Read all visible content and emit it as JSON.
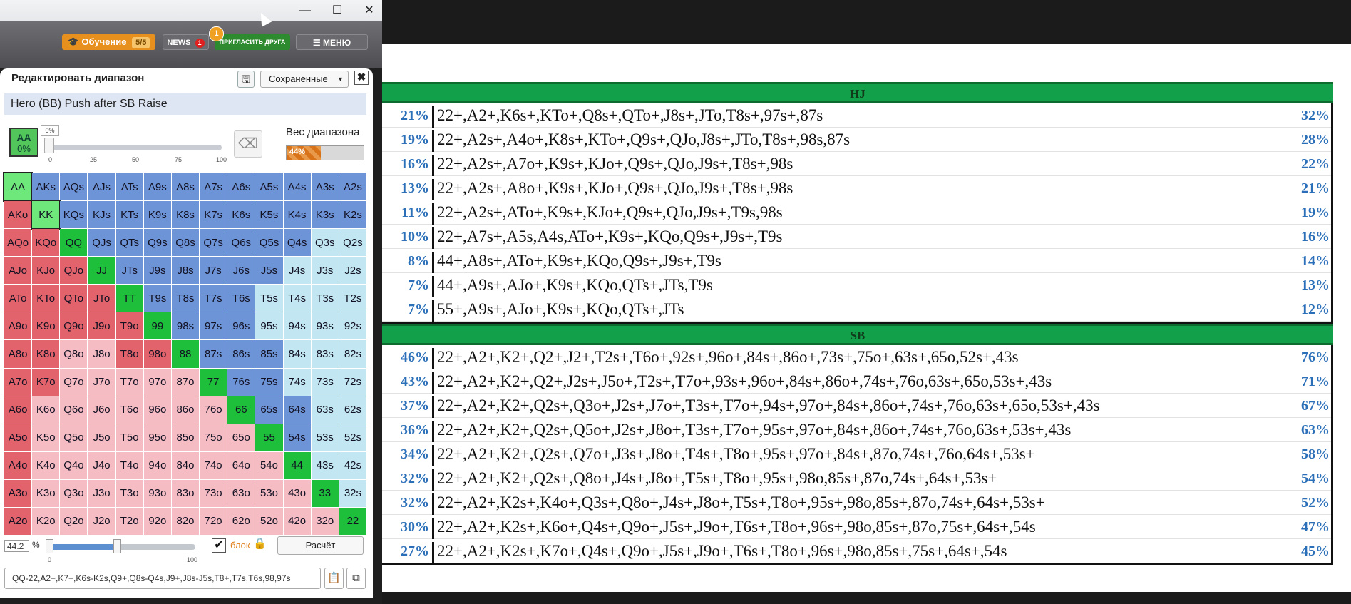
{
  "window": {
    "minimize": "—",
    "maximize": "☐",
    "close": "✕"
  },
  "toolbar": {
    "learn_icon": "🎓",
    "learn_label": "Обучение",
    "learn_count": "5/5",
    "news_label": "NEWS",
    "news_badge": "1",
    "invite_label": "ПРИГЛАСИТЬ ДРУГА",
    "invite_badge": "1",
    "menu_icon": "☰",
    "menu_label": "МЕНЮ"
  },
  "panel": {
    "title": "Редактировать диапазон",
    "save_icon": "🖫",
    "saved_label": "Сохранённые",
    "saved_caret": "▼",
    "close_icon": "✖",
    "range_name": "Hero (BB) Push after SB Raise",
    "combo_label": "AA",
    "combo_pct": "0%",
    "slider_tip": "0%",
    "ticks": [
      "0",
      "25",
      "50",
      "75",
      "100"
    ],
    "eraser_icon": "⌫",
    "weight_label": "Вес диапазона",
    "weight_pct": 44,
    "weight_text": "44%",
    "pct_value": "44.2",
    "pct_sign": "%",
    "bottom_ticks": [
      "0",
      "100"
    ],
    "block_check": "✔",
    "block_label": "блок",
    "lock_icon": "🔒",
    "calc_label": "Расчёт",
    "range_string": "QQ-22,A2+,K7+,K6s-K2s,Q9+,Q8s-Q4s,J9+,J8s-J5s,T8+,T7s,T6s,98,97s",
    "paste_icon": "📋",
    "copy_icon": "⧉"
  },
  "grid": {
    "colors": {
      "pair": "#1ebf3a",
      "selected": "#6ee87a",
      "suited": "#6e94d8",
      "suited_light": "#c2e6f2",
      "offsuit": "#e2636c",
      "offsuit_light": "#f5bcc4"
    },
    "cells": [
      [
        "AA",
        "selected"
      ],
      [
        "AKs",
        "suited"
      ],
      [
        "AQs",
        "suited"
      ],
      [
        "AJs",
        "suited"
      ],
      [
        "ATs",
        "suited"
      ],
      [
        "A9s",
        "suited"
      ],
      [
        "A8s",
        "suited"
      ],
      [
        "A7s",
        "suited"
      ],
      [
        "A6s",
        "suited"
      ],
      [
        "A5s",
        "suited"
      ],
      [
        "A4s",
        "suited"
      ],
      [
        "A3s",
        "suited"
      ],
      [
        "A2s",
        "suited"
      ],
      [
        "AKo",
        "offsuit"
      ],
      [
        "KK",
        "selected"
      ],
      [
        "KQs",
        "suited"
      ],
      [
        "KJs",
        "suited"
      ],
      [
        "KTs",
        "suited"
      ],
      [
        "K9s",
        "suited"
      ],
      [
        "K8s",
        "suited"
      ],
      [
        "K7s",
        "suited"
      ],
      [
        "K6s",
        "suited"
      ],
      [
        "K5s",
        "suited"
      ],
      [
        "K4s",
        "suited"
      ],
      [
        "K3s",
        "suited"
      ],
      [
        "K2s",
        "suited"
      ],
      [
        "AQo",
        "offsuit"
      ],
      [
        "KQo",
        "offsuit"
      ],
      [
        "QQ",
        "pair"
      ],
      [
        "QJs",
        "suited"
      ],
      [
        "QTs",
        "suited"
      ],
      [
        "Q9s",
        "suited"
      ],
      [
        "Q8s",
        "suited"
      ],
      [
        "Q7s",
        "suited"
      ],
      [
        "Q6s",
        "suited"
      ],
      [
        "Q5s",
        "suited"
      ],
      [
        "Q4s",
        "suited"
      ],
      [
        "Q3s",
        "suited_light"
      ],
      [
        "Q2s",
        "suited_light"
      ],
      [
        "AJo",
        "offsuit"
      ],
      [
        "KJo",
        "offsuit"
      ],
      [
        "QJo",
        "offsuit"
      ],
      [
        "JJ",
        "pair"
      ],
      [
        "JTs",
        "suited"
      ],
      [
        "J9s",
        "suited"
      ],
      [
        "J8s",
        "suited"
      ],
      [
        "J7s",
        "suited"
      ],
      [
        "J6s",
        "suited"
      ],
      [
        "J5s",
        "suited"
      ],
      [
        "J4s",
        "suited_light"
      ],
      [
        "J3s",
        "suited_light"
      ],
      [
        "J2s",
        "suited_light"
      ],
      [
        "ATo",
        "offsuit"
      ],
      [
        "KTo",
        "offsuit"
      ],
      [
        "QTo",
        "offsuit"
      ],
      [
        "JTo",
        "offsuit"
      ],
      [
        "TT",
        "pair"
      ],
      [
        "T9s",
        "suited"
      ],
      [
        "T8s",
        "suited"
      ],
      [
        "T7s",
        "suited"
      ],
      [
        "T6s",
        "suited"
      ],
      [
        "T5s",
        "suited_light"
      ],
      [
        "T4s",
        "suited_light"
      ],
      [
        "T3s",
        "suited_light"
      ],
      [
        "T2s",
        "suited_light"
      ],
      [
        "A9o",
        "offsuit"
      ],
      [
        "K9o",
        "offsuit"
      ],
      [
        "Q9o",
        "offsuit"
      ],
      [
        "J9o",
        "offsuit"
      ],
      [
        "T9o",
        "offsuit"
      ],
      [
        "99",
        "pair"
      ],
      [
        "98s",
        "suited"
      ],
      [
        "97s",
        "suited"
      ],
      [
        "96s",
        "suited"
      ],
      [
        "95s",
        "suited_light"
      ],
      [
        "94s",
        "suited_light"
      ],
      [
        "93s",
        "suited_light"
      ],
      [
        "92s",
        "suited_light"
      ],
      [
        "A8o",
        "offsuit"
      ],
      [
        "K8o",
        "offsuit"
      ],
      [
        "Q8o",
        "offsuit_light"
      ],
      [
        "J8o",
        "offsuit_light"
      ],
      [
        "T8o",
        "offsuit"
      ],
      [
        "98o",
        "offsuit"
      ],
      [
        "88",
        "pair"
      ],
      [
        "87s",
        "suited"
      ],
      [
        "86s",
        "suited"
      ],
      [
        "85s",
        "suited"
      ],
      [
        "84s",
        "suited_light"
      ],
      [
        "83s",
        "suited_light"
      ],
      [
        "82s",
        "suited_light"
      ],
      [
        "A7o",
        "offsuit"
      ],
      [
        "K7o",
        "offsuit"
      ],
      [
        "Q7o",
        "offsuit_light"
      ],
      [
        "J7o",
        "offsuit_light"
      ],
      [
        "T7o",
        "offsuit_light"
      ],
      [
        "97o",
        "offsuit_light"
      ],
      [
        "87o",
        "offsuit_light"
      ],
      [
        "77",
        "pair"
      ],
      [
        "76s",
        "suited"
      ],
      [
        "75s",
        "suited"
      ],
      [
        "74s",
        "suited_light"
      ],
      [
        "73s",
        "suited_light"
      ],
      [
        "72s",
        "suited_light"
      ],
      [
        "A6o",
        "offsuit"
      ],
      [
        "K6o",
        "offsuit_light"
      ],
      [
        "Q6o",
        "offsuit_light"
      ],
      [
        "J6o",
        "offsuit_light"
      ],
      [
        "T6o",
        "offsuit_light"
      ],
      [
        "96o",
        "offsuit_light"
      ],
      [
        "86o",
        "offsuit_light"
      ],
      [
        "76o",
        "offsuit_light"
      ],
      [
        "66",
        "pair"
      ],
      [
        "65s",
        "suited"
      ],
      [
        "64s",
        "suited"
      ],
      [
        "63s",
        "suited_light"
      ],
      [
        "62s",
        "suited_light"
      ],
      [
        "A5o",
        "offsuit"
      ],
      [
        "K5o",
        "offsuit_light"
      ],
      [
        "Q5o",
        "offsuit_light"
      ],
      [
        "J5o",
        "offsuit_light"
      ],
      [
        "T5o",
        "offsuit_light"
      ],
      [
        "95o",
        "offsuit_light"
      ],
      [
        "85o",
        "offsuit_light"
      ],
      [
        "75o",
        "offsuit_light"
      ],
      [
        "65o",
        "offsuit_light"
      ],
      [
        "55",
        "pair"
      ],
      [
        "54s",
        "suited"
      ],
      [
        "53s",
        "suited_light"
      ],
      [
        "52s",
        "suited_light"
      ],
      [
        "A4o",
        "offsuit"
      ],
      [
        "K4o",
        "offsuit_light"
      ],
      [
        "Q4o",
        "offsuit_light"
      ],
      [
        "J4o",
        "offsuit_light"
      ],
      [
        "T4o",
        "offsuit_light"
      ],
      [
        "94o",
        "offsuit_light"
      ],
      [
        "84o",
        "offsuit_light"
      ],
      [
        "74o",
        "offsuit_light"
      ],
      [
        "64o",
        "offsuit_light"
      ],
      [
        "54o",
        "offsuit_light"
      ],
      [
        "44",
        "pair"
      ],
      [
        "43s",
        "suited_light"
      ],
      [
        "42s",
        "suited_light"
      ],
      [
        "A3o",
        "offsuit"
      ],
      [
        "K3o",
        "offsuit_light"
      ],
      [
        "Q3o",
        "offsuit_light"
      ],
      [
        "J3o",
        "offsuit_light"
      ],
      [
        "T3o",
        "offsuit_light"
      ],
      [
        "93o",
        "offsuit_light"
      ],
      [
        "83o",
        "offsuit_light"
      ],
      [
        "73o",
        "offsuit_light"
      ],
      [
        "63o",
        "offsuit_light"
      ],
      [
        "53o",
        "offsuit_light"
      ],
      [
        "43o",
        "offsuit_light"
      ],
      [
        "33",
        "pair"
      ],
      [
        "32s",
        "suited_light"
      ],
      [
        "A2o",
        "offsuit"
      ],
      [
        "K2o",
        "offsuit_light"
      ],
      [
        "Q2o",
        "offsuit_light"
      ],
      [
        "J2o",
        "offsuit_light"
      ],
      [
        "T2o",
        "offsuit_light"
      ],
      [
        "92o",
        "offsuit_light"
      ],
      [
        "82o",
        "offsuit_light"
      ],
      [
        "72o",
        "offsuit_light"
      ],
      [
        "62o",
        "offsuit_light"
      ],
      [
        "52o",
        "offsuit_light"
      ],
      [
        "42o",
        "offsuit_light"
      ],
      [
        "32o",
        "offsuit_light"
      ],
      [
        "22",
        "pair"
      ]
    ]
  },
  "sheet": {
    "hj_header": "HJ",
    "hj_rows": [
      [
        "21%",
        "22+,A2+,K6s+,KTo+,Q8s+,QTo+,J8s+,JTo,T8s+,97s+,87s",
        "32%"
      ],
      [
        "19%",
        "22+,A2s+,A4o+,K8s+,KTo+,Q9s+,QJo,J8s+,JTo,T8s+,98s,87s",
        "28%"
      ],
      [
        "16%",
        "22+,A2s+,A7o+,K9s+,KJo+,Q9s+,QJo,J9s+,T8s+,98s",
        "22%"
      ],
      [
        "13%",
        "22+,A2s+,A8o+,K9s+,KJo+,Q9s+,QJo,J9s+,T8s+,98s",
        "21%"
      ],
      [
        "11%",
        "22+,A2s+,ATo+,K9s+,KJo+,Q9s+,QJo,J9s+,T9s,98s",
        "19%"
      ],
      [
        "10%",
        "22+,A7s+,A5s,A4s,ATo+,K9s+,KQo,Q9s+,J9s+,T9s",
        "16%"
      ],
      [
        "8%",
        "44+,A8s+,ATo+,K9s+,KQo,Q9s+,J9s+,T9s",
        "14%"
      ],
      [
        "7%",
        "44+,A9s+,AJo+,K9s+,KQo,QTs+,JTs,T9s",
        "13%"
      ],
      [
        "7%",
        "55+,A9s+,AJo+,K9s+,KQo,QTs+,JTs",
        "12%"
      ]
    ],
    "sb_header": "SB",
    "sb_rows": [
      [
        "46%",
        "22+,A2+,K2+,Q2+,J2+,T2s+,T6o+,92s+,96o+,84s+,86o+,73s+,75o+,63s+,65o,52s+,43s",
        "76%"
      ],
      [
        "43%",
        "22+,A2+,K2+,Q2+,J2s+,J5o+,T2s+,T7o+,93s+,96o+,84s+,86o+,74s+,76o,63s+,65o,53s+,43s",
        "71%"
      ],
      [
        "37%",
        "22+,A2+,K2+,Q2s+,Q3o+,J2s+,J7o+,T3s+,T7o+,94s+,97o+,84s+,86o+,74s+,76o,63s+,65o,53s+,43s",
        "67%"
      ],
      [
        "36%",
        "22+,A2+,K2+,Q2s+,Q5o+,J2s+,J8o+,T3s+,T7o+,95s+,97o+,84s+,86o+,74s+,76o,63s+,53s+,43s",
        "63%"
      ],
      [
        "34%",
        "22+,A2+,K2+,Q2s+,Q7o+,J3s+,J8o+,T4s+,T8o+,95s+,97o+,84s+,87o,74s+,76o,64s+,53s+",
        "58%"
      ],
      [
        "32%",
        "22+,A2+,K2+,Q2s+,Q8o+,J4s+,J8o+,T5s+,T8o+,95s+,98o,85s+,87o,74s+,64s+,53s+",
        "54%"
      ],
      [
        "32%",
        "22+,A2+,K2s+,K4o+,Q3s+,Q8o+,J4s+,J8o+,T5s+,T8o+,95s+,98o,85s+,87o,74s+,64s+,53s+",
        "52%"
      ],
      [
        "30%",
        "22+,A2+,K2s+,K6o+,Q4s+,Q9o+,J5s+,J9o+,T6s+,T8o+,96s+,98o,85s+,87o,75s+,64s+,54s",
        "47%"
      ],
      [
        "27%",
        "22+,A2+,K2s+,K7o+,Q4s+,Q9o+,J5s+,J9o+,T6s+,T8o+,96s+,98o,85s+,75s+,64s+,54s",
        "45%"
      ]
    ]
  }
}
